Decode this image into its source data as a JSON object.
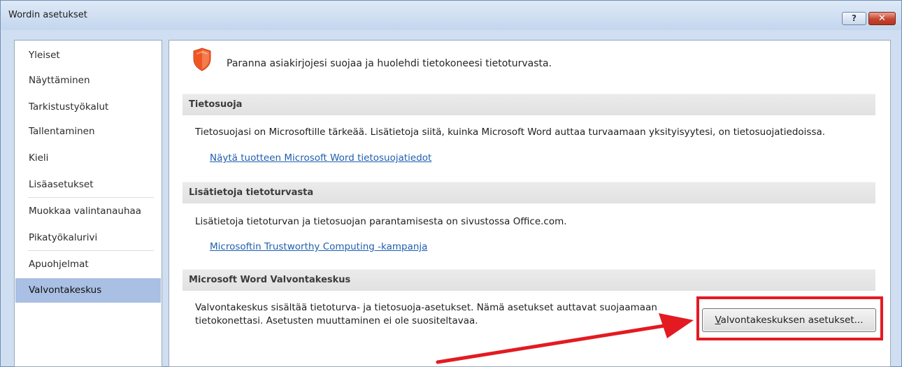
{
  "window": {
    "title": "Wordin asetukset",
    "help_label": "?",
    "close_label": "✕"
  },
  "sidebar": {
    "items": [
      {
        "label": "Yleiset"
      },
      {
        "label": "Näyttäminen"
      },
      {
        "label": "Tarkistustyökalut"
      },
      {
        "label": "Tallentaminen"
      },
      {
        "label": "Kieli"
      },
      {
        "label": "Lisäasetukset"
      },
      {
        "label": "Muokkaa valintanauhaa"
      },
      {
        "label": "Pikatyökalurivi"
      },
      {
        "label": "Apuohjelmat"
      },
      {
        "label": "Valvontakeskus"
      }
    ],
    "active": "Valvontakeskus"
  },
  "content": {
    "intro": "Paranna asiakirjojesi suojaa ja huolehdi tietokoneesi tietoturvasta.",
    "privacy": {
      "heading": "Tietosuoja",
      "text": "Tietosuojasi on Microsoftille tärkeää. Lisätietoja siitä, kuinka Microsoft Word auttaa turvaamaan yksityisyytesi, on tietosuojatiedoissa.",
      "link": "Näytä tuotteen Microsoft Word tietosuojatiedot"
    },
    "security": {
      "heading": "Lisätietoja tietoturvasta",
      "text": "Lisätietoja tietoturvan ja tietosuojan parantamisesta on sivustossa Office.com.",
      "link": "Microsoftin Trustworthy Computing -kampanja"
    },
    "trust_center": {
      "heading": "Microsoft Word Valvontakeskus",
      "text": "Valvontakeskus sisältää tietoturva- ja tietosuoja-asetukset. Nämä asetukset auttavat suojaamaan tietokonettasi. Asetusten muuttaminen ei ole suositeltavaa.",
      "button": "Valvontakeskuksen asetukset..."
    }
  },
  "colors": {
    "shield": "#f05a28",
    "link": "#1f5fae",
    "highlight": "#e31a22",
    "active_nav": "#a9bfe3"
  }
}
